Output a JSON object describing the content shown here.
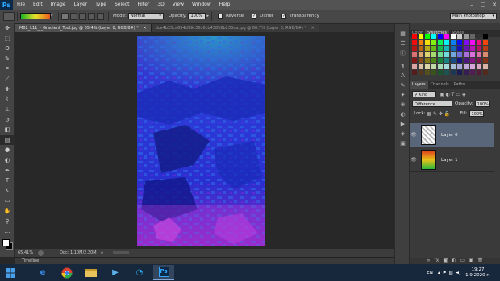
{
  "app": {
    "logo": "Ps",
    "menu": [
      "File",
      "Edit",
      "Image",
      "Layer",
      "Type",
      "Select",
      "Filter",
      "3D",
      "View",
      "Window",
      "Help"
    ],
    "window_controls": [
      "–",
      "□",
      "✕"
    ]
  },
  "options": {
    "mode_label": "Mode:",
    "mode_value": "Normal",
    "opacity_label": "Opacity:",
    "opacity_value": "100%",
    "reverse_label": "Reverse",
    "dither_label": "Dither",
    "transparency_label": "Transparency",
    "workspace": "Main Photoshop"
  },
  "doc_tabs": [
    {
      "label": "M02_L11_-_Gradient_Tool.jpg @ 65.4% (Layer 0, RGB/8#) *",
      "active": true
    },
    {
      "label": "dce4b25ca694d99c36d6cb43858b233aa.jpg @ 66.7% (Layer 0, RGB/8#) *",
      "active": false
    }
  ],
  "status": {
    "zoom": "65.41%",
    "doc_size": "Doc: 1.10M/2.30M"
  },
  "timeline_label": "Timeline",
  "right_panel": {
    "top_tabs": [
      "Color",
      "Swatches",
      "Styles"
    ],
    "top_active": "Swatches",
    "layer_tabs": [
      "Layers",
      "Channels",
      "Paths"
    ],
    "layer_active": "Layers",
    "kind_label": "Kind",
    "blend_mode": "Difference",
    "opacity_label": "Opacity:",
    "opacity_value": "100%",
    "lock_label": "Lock:",
    "fill_label": "Fill:",
    "fill_value": "100%",
    "layers": [
      {
        "name": "Layer 0",
        "selected": true
      },
      {
        "name": "Layer 1",
        "selected": false
      }
    ]
  },
  "taskbar": {
    "language": "EN",
    "time": "19:27",
    "date": "1.9.2020 г."
  },
  "colors": {
    "accent": "#31a8ff",
    "selected_layer": "#59667a",
    "taskbar": "#17273c"
  }
}
